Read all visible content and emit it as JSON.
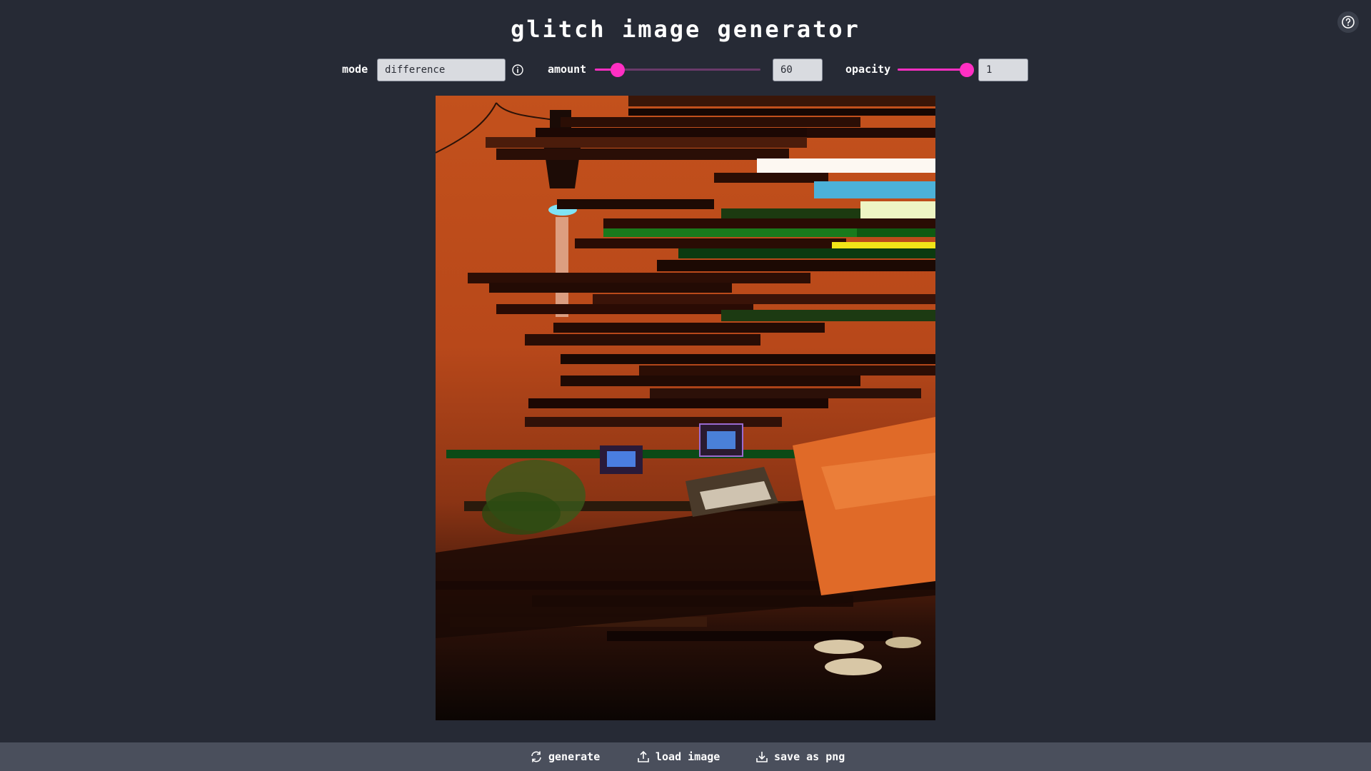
{
  "app": {
    "title": "glitch image generator"
  },
  "controls": {
    "mode": {
      "label": "mode",
      "value": "difference"
    },
    "amount": {
      "label": "amount",
      "value": "60",
      "fraction": 0.14
    },
    "opacity": {
      "label": "opacity",
      "value": "1",
      "fraction": 1.0
    }
  },
  "actions": {
    "generate": "generate",
    "load": "load image",
    "save": "save as png"
  },
  "icons": {
    "help": "question-circle-icon",
    "info": "info-circle-icon",
    "generate": "refresh-icon",
    "load": "upload-icon",
    "save": "download-icon"
  },
  "colors": {
    "background": "#262a35",
    "accent": "#ff2fc3",
    "bottom_bar": "#4a4f5c"
  }
}
